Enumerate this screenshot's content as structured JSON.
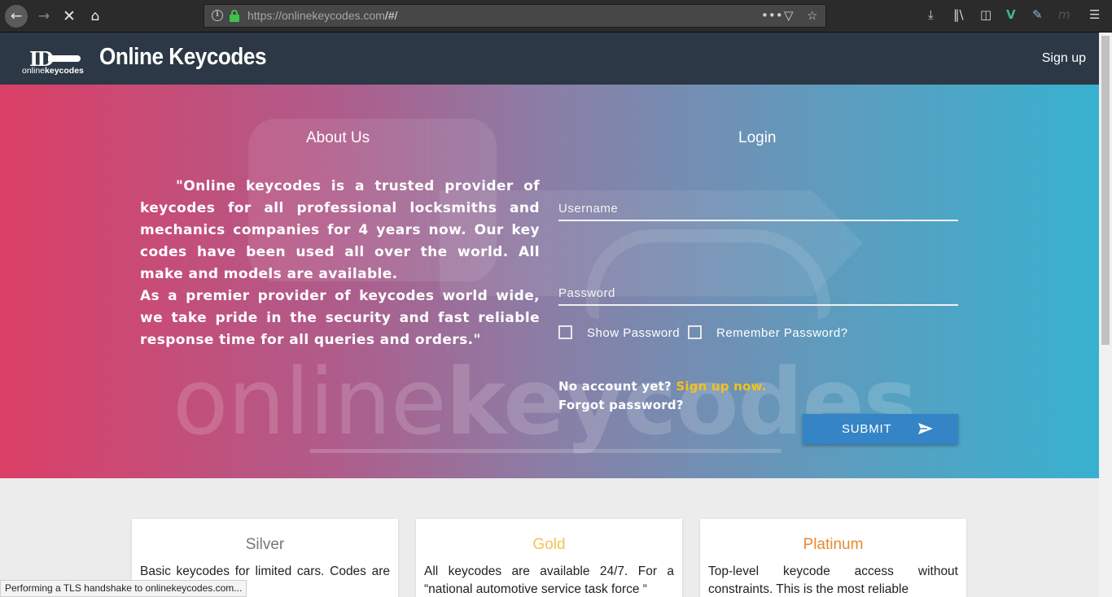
{
  "browser": {
    "url_host": "https://onlinekeycodes.com",
    "url_path": "/#/",
    "icons": {
      "back": "back-arrow-icon",
      "forward": "forward-arrow-icon",
      "stop": "stop-loading-icon",
      "home": "home-icon",
      "page_actions": "ellipsis-icon",
      "pocket": "pocket-icon",
      "bookmark": "star-icon",
      "downloads": "download-icon",
      "library": "library-icon",
      "sidebar": "sidebar-icon",
      "vue_devtools": "vue-icon",
      "eyedropper": "pen-icon",
      "extension": "extension-icon",
      "menu": "hamburger-menu-icon"
    }
  },
  "header": {
    "logo_text_light": "online",
    "logo_text_bold": "keycodes",
    "brand_title": "Online Keycodes",
    "signup_link": "Sign up",
    "background": "#2c3845"
  },
  "hero": {
    "watermark_light": "online",
    "watermark_bold": "keycodes",
    "gradient_start": "#db3f66",
    "gradient_end": "#38b1d0"
  },
  "about": {
    "title": "About Us",
    "paragraph1": "\"Online keycodes is a trusted provider of keycodes for all professional locksmiths and mechanics companies for 4 years now. Our key codes have been used all over the world. All make and models are available.",
    "paragraph2": "As a premier provider of keycodes world wide, we take pride in the security and fast reliable response time for all queries and orders.\""
  },
  "login": {
    "title": "Login",
    "username_placeholder": "Username",
    "username_value": "",
    "password_placeholder": "Password",
    "password_value": "",
    "show_password_label": "Show Password",
    "show_password_checked": false,
    "remember_label": "Remember Password?",
    "remember_checked": false,
    "no_account_text": "No account yet?",
    "signup_now_link": "Sign up now.",
    "forgot_link": "Forgot password?",
    "submit_label": "SUBMIT",
    "submit_color": "#3584c6",
    "link_color": "#f5c117"
  },
  "plans": [
    {
      "name": "Silver",
      "color": "#777777",
      "description": "Basic keycodes for limited cars. Codes are from other source"
    },
    {
      "name": "Gold",
      "color": "#f2c453",
      "description": "All keycodes are available 24/7.  For a “national automotive service task force “"
    },
    {
      "name": "Platinum",
      "color": "#e98933",
      "description": "Top-level keycode access without constraints.  This is the most reliable"
    }
  ],
  "status_text": "Performing a TLS handshake to onlinekeycodes.com..."
}
